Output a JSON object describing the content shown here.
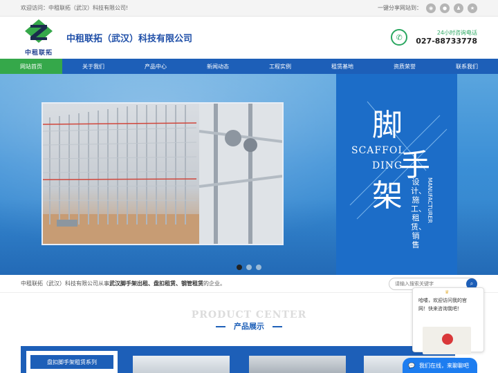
{
  "topbar": {
    "welcome": "欢迎访问：中租联拓（武汉）科技有限公司!",
    "share_label": "一键分享网站到："
  },
  "header": {
    "logo_text": "中租联拓",
    "company_name": "中租联拓（武汉）科技有限公司",
    "hotline_label": "24小时咨询电话",
    "hotline_number": "027-88733778"
  },
  "nav": {
    "items": [
      "网站首页",
      "关于我们",
      "产品中心",
      "新闻动态",
      "工程实例",
      "租赁基地",
      "资质荣誉",
      "联系我们"
    ]
  },
  "banner": {
    "char1": "脚",
    "char2": "手",
    "char3": "架",
    "en_line1": "SCAFFOL",
    "en_line2": "DING",
    "services": "设计、施工、租赁、销售",
    "manufacturer": "MANUFACTURER"
  },
  "intro": {
    "prefix": "中租联拓（武汉）科技有限公司从事",
    "highlight": "武汉脚手架出租、盘扣租赁、钢管租赁",
    "suffix": "的企业。",
    "search_placeholder": "请输入搜索关键字"
  },
  "products": {
    "title_en": "PRODUCT CENTER",
    "title_cn": "产品展示",
    "side_item": "盘扣脚手架租赁系列"
  },
  "chat": {
    "greeting": "哈喽，欢迎访问我的官网！快来咨询我吧！",
    "bar_label": "我们在线，来聊聊吧"
  },
  "colors": {
    "brand_blue": "#1d5fb8",
    "nav_active_green": "#35a84a",
    "hotline_green": "#2aa760"
  }
}
